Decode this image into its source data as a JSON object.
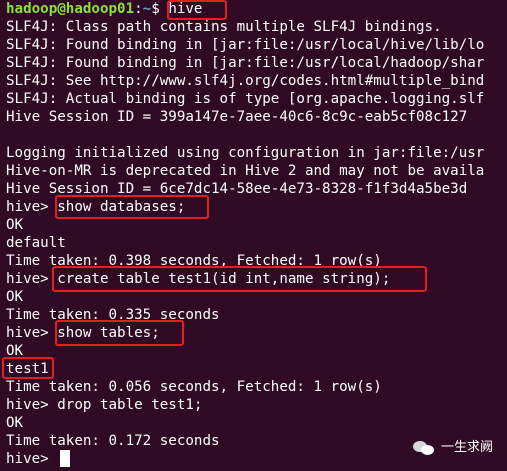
{
  "terminal": {
    "prompt": {
      "user_host": "hadoop@hadoop01",
      "separator": ":",
      "path": "~",
      "symbol": "$ ",
      "command": "hive"
    },
    "lines": [
      "SLF4J: Class path contains multiple SLF4J bindings.",
      "SLF4J: Found binding in [jar:file:/usr/local/hive/lib/lo",
      "SLF4J: Found binding in [jar:file:/usr/local/hadoop/shar",
      "SLF4J: See http://www.slf4j.org/codes.html#multiple_bind",
      "SLF4J: Actual binding is of type [org.apache.logging.slf",
      "Hive Session ID = 399a147e-7aee-40c6-8c9c-eab5cf08c127",
      "",
      "Logging initialized using configuration in jar:file:/usr",
      "Hive-on-MR is deprecated in Hive 2 and may not be availa",
      "Hive Session ID = 6ce7dc14-58ee-4e73-8328-f1f3d4a5be3d",
      "hive> show databases;",
      "OK",
      "default",
      "Time taken: 0.398 seconds, Fetched: 1 row(s)",
      "hive> create table test1(id int,name string);",
      "OK",
      "Time taken: 0.335 seconds",
      "hive> show tables;",
      "OK",
      "test1",
      "Time taken: 0.056 seconds, Fetched: 1 row(s)",
      "hive> drop table test1;",
      "OK",
      "Time taken: 0.172 seconds",
      "hive> "
    ]
  },
  "watermark": {
    "text": "一生求阙",
    "icon": "wechat-icon"
  },
  "colors": {
    "background": "#300a24",
    "prompt_user": "#8ae234",
    "prompt_path": "#729fcf",
    "highlight_box": "#e02020"
  }
}
